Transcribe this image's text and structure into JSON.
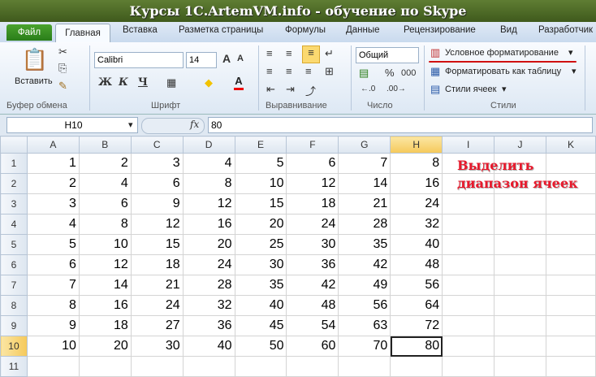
{
  "window": {
    "title": "Курсы 1С.ArtemVM.info - обучение по Skype"
  },
  "tabs": [
    {
      "label": "Файл"
    },
    {
      "label": "Главная"
    },
    {
      "label": "Вставка"
    },
    {
      "label": "Разметка страницы"
    },
    {
      "label": "Формулы"
    },
    {
      "label": "Данные"
    },
    {
      "label": "Рецензирование"
    },
    {
      "label": "Вид"
    },
    {
      "label": "Разработчик"
    }
  ],
  "ribbon": {
    "clipboard": {
      "paste_label": "Вставить",
      "group_label": "Буфер обмена"
    },
    "font": {
      "name": "Calibri",
      "size": "14",
      "bold": "Ж",
      "italic": "К",
      "underline": "Ч",
      "grow": "A",
      "shrink": "A",
      "color_letter": "A",
      "group_label": "Шрифт"
    },
    "alignment": {
      "group_label": "Выравнивание"
    },
    "number": {
      "format": "Общий",
      "percent": "%",
      "thousands": "000",
      "group_label": "Число"
    },
    "styles": {
      "conditional_formatting": "Условное форматирование",
      "format_as_table": "Форматировать как таблицу",
      "cell_styles": "Стили ячеек",
      "group_label": "Стили"
    }
  },
  "formula_bar": {
    "name_box": "H10",
    "fx": "fx",
    "value": "80"
  },
  "sheet": {
    "columns": [
      "A",
      "B",
      "C",
      "D",
      "E",
      "F",
      "G",
      "H",
      "I",
      "J",
      "K"
    ],
    "selected_column": "H",
    "selected_row": "10",
    "rows": [
      {
        "num": "1",
        "cells": [
          "1",
          "2",
          "3",
          "4",
          "5",
          "6",
          "7",
          "8"
        ]
      },
      {
        "num": "2",
        "cells": [
          "2",
          "4",
          "6",
          "8",
          "10",
          "12",
          "14",
          "16"
        ]
      },
      {
        "num": "3",
        "cells": [
          "3",
          "6",
          "9",
          "12",
          "15",
          "18",
          "21",
          "24"
        ]
      },
      {
        "num": "4",
        "cells": [
          "4",
          "8",
          "12",
          "16",
          "20",
          "24",
          "28",
          "32"
        ]
      },
      {
        "num": "5",
        "cells": [
          "5",
          "10",
          "15",
          "20",
          "25",
          "30",
          "35",
          "40"
        ]
      },
      {
        "num": "6",
        "cells": [
          "6",
          "12",
          "18",
          "24",
          "30",
          "36",
          "42",
          "48"
        ]
      },
      {
        "num": "7",
        "cells": [
          "7",
          "14",
          "21",
          "28",
          "35",
          "42",
          "49",
          "56"
        ]
      },
      {
        "num": "8",
        "cells": [
          "8",
          "16",
          "24",
          "32",
          "40",
          "48",
          "56",
          "64"
        ]
      },
      {
        "num": "9",
        "cells": [
          "9",
          "18",
          "27",
          "36",
          "45",
          "54",
          "63",
          "72"
        ]
      },
      {
        "num": "10",
        "cells": [
          "10",
          "20",
          "30",
          "40",
          "50",
          "60",
          "70",
          "80"
        ]
      },
      {
        "num": "11",
        "cells": [
          "",
          "",
          "",
          "",
          "",
          "",
          "",
          ""
        ]
      }
    ]
  },
  "annotation": {
    "line1": "Выделить",
    "line2": "диапазон ячеек",
    "color": "#e8192c"
  }
}
